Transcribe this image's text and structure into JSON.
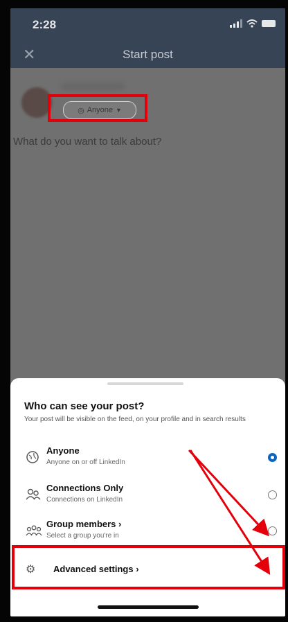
{
  "status": {
    "time": "2:28"
  },
  "nav": {
    "close_glyph": "✕",
    "title": "Start post"
  },
  "composer": {
    "audience_chip": "Anyone",
    "prompt": "What do you want to talk about?"
  },
  "sheet": {
    "title": "Who can see your post?",
    "description": "Your post will be visible on the feed, on your profile and in search results",
    "options": [
      {
        "label": "Anyone",
        "sub": "Anyone on or off LinkedIn",
        "selected": true,
        "icon": "globe-icon"
      },
      {
        "label": "Connections Only",
        "sub": "Connections on LinkedIn",
        "selected": false,
        "icon": "people-icon"
      },
      {
        "label": "Group members ›",
        "sub": "Select a group you're in",
        "selected": false,
        "icon": "group-icon"
      }
    ],
    "advanced": {
      "label": "Advanced settings ›",
      "icon": "gear-icon"
    }
  },
  "colors": {
    "accent": "#0a66c2",
    "highlight": "#e3000b"
  }
}
